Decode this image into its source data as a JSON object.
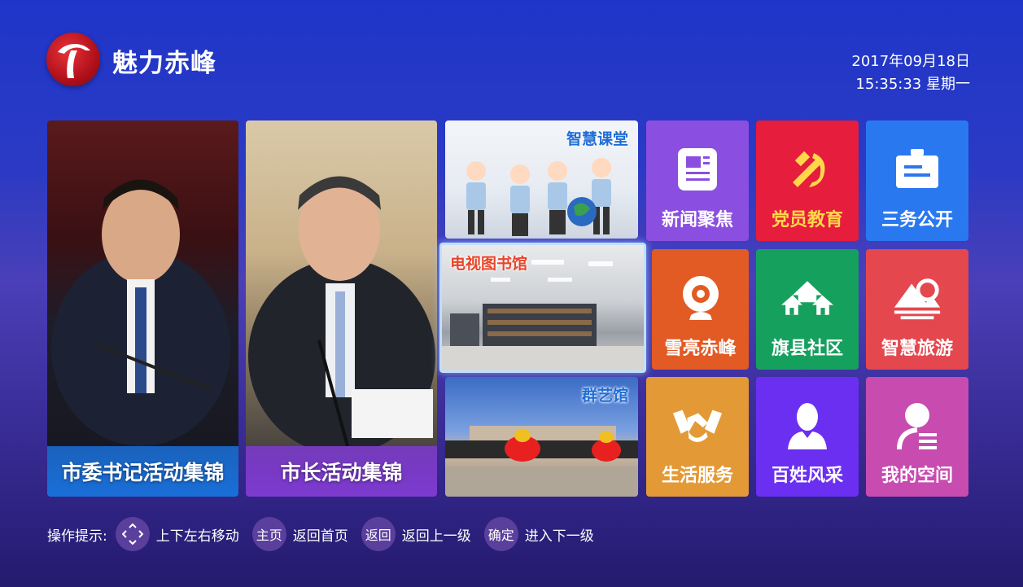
{
  "header": {
    "app_title": "魅力赤峰",
    "date": "2017年09月18日",
    "time_weekday": "15:35:33 星期一"
  },
  "feature_tiles": [
    {
      "caption": "市委书记活动集锦",
      "caption_color": "#1a6fd8"
    },
    {
      "caption": "市长活动集锦",
      "caption_color": "#7d3ad0"
    }
  ],
  "mini_tiles": [
    {
      "label": "智慧课堂"
    },
    {
      "label": "电视图书馆"
    },
    {
      "label": "群艺馆"
    }
  ],
  "service_tiles": [
    {
      "label": "新闻聚焦",
      "icon": "news-icon",
      "color": "#8a4fe0",
      "label_color": "#ffffff"
    },
    {
      "label": "党员教育",
      "icon": "party-emblem-icon",
      "color": "#e61d3c",
      "label_color": "#ffd84a"
    },
    {
      "label": "三务公开",
      "icon": "notice-board-icon",
      "color": "#2a78f0",
      "label_color": "#ffffff"
    },
    {
      "label": "雪亮赤峰",
      "icon": "camera-icon",
      "color": "#e25a24",
      "label_color": "#ffffff"
    },
    {
      "label": "旗县社区",
      "icon": "houses-icon",
      "color": "#16a05e",
      "label_color": "#ffffff"
    },
    {
      "label": "智慧旅游",
      "icon": "mountain-icon",
      "color": "#e4474e",
      "label_color": "#ffffff"
    },
    {
      "label": "生活服务",
      "icon": "handshake-icon",
      "color": "#e39a36",
      "label_color": "#ffffff"
    },
    {
      "label": "百姓风采",
      "icon": "person-icon",
      "color": "#6a2ff0",
      "label_color": "#ffffff"
    },
    {
      "label": "我的空间",
      "icon": "user-space-icon",
      "color": "#c84bb0",
      "label_color": "#ffffff"
    }
  ],
  "hints": {
    "prefix": "操作提示:",
    "dpad_text": "上下左右移动",
    "home_key": "主页",
    "home_text": "返回首页",
    "back_key": "返回",
    "back_text": "返回上一级",
    "ok_key": "确定",
    "ok_text": "进入下一级"
  }
}
